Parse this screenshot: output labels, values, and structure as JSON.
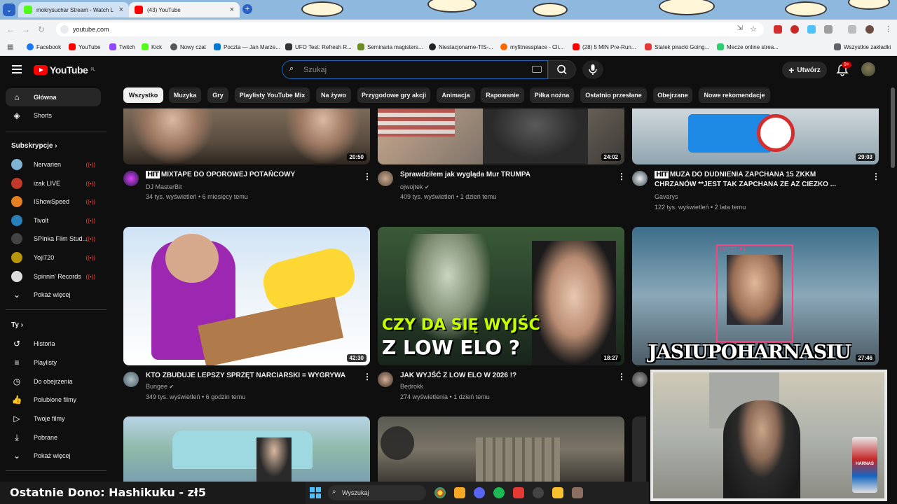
{
  "browser": {
    "tabs": [
      {
        "label": "mokrysuchar Stream - Watch L",
        "favicon_color": "#53fc18"
      },
      {
        "label": "(43) YouTube",
        "favicon_color": "#ff0000"
      }
    ],
    "url": "youtube.com",
    "bookmarks": [
      {
        "label": "Facebook",
        "color": "#1877f2"
      },
      {
        "label": "YouTube",
        "color": "#ff0000"
      },
      {
        "label": "Twitch",
        "color": "#9146ff"
      },
      {
        "label": "Kick",
        "color": "#53fc18"
      },
      {
        "label": "Nowy czat",
        "color": "#555555"
      },
      {
        "label": "Poczta — Jan Marze...",
        "color": "#0078d4"
      },
      {
        "label": "UFO Test: Refresh R...",
        "color": "#333333"
      },
      {
        "label": "Seminaria magisters...",
        "color": "#6b8e23"
      },
      {
        "label": "Niestacjonarne-TIS-...",
        "color": "#222222"
      },
      {
        "label": "myfitnessplace - Cli...",
        "color": "#ff6a00"
      },
      {
        "label": "(28) 5 MIN Pre-Run...",
        "color": "#ff0000"
      },
      {
        "label": "Statek piracki Going...",
        "color": "#e53935"
      },
      {
        "label": "Mecze online strea...",
        "color": "#2ecc71"
      }
    ],
    "all_bookmarks": "Wszystkie zakładki"
  },
  "header": {
    "logo": "YouTube",
    "region": "PL",
    "search_placeholder": "Szukaj",
    "create_label": "Utwórz",
    "notifications": "9+"
  },
  "sidebar": {
    "main": [
      {
        "label": "Główna",
        "icon": "home-icon",
        "glyph": "⌂"
      },
      {
        "label": "Shorts",
        "icon": "shorts-icon",
        "glyph": "◈"
      }
    ],
    "subscriptions_heading": "Subskrypcje",
    "subscriptions": [
      {
        "label": "Nervarien",
        "color": "#7fb3d5"
      },
      {
        "label": "izak LIVE",
        "color": "#c0392b"
      },
      {
        "label": "IShowSpeed",
        "color": "#e67e22"
      },
      {
        "label": "Tivolt",
        "color": "#2980b9"
      },
      {
        "label": "SPInka Film Stud...",
        "color": "#444444"
      },
      {
        "label": "Yoji720",
        "color": "#b7950b"
      },
      {
        "label": "Spinnin' Records",
        "color": "#dddddd"
      }
    ],
    "show_more": "Pokaż więcej",
    "you_heading": "Ty",
    "you_items": [
      {
        "label": "Historia",
        "icon": "history-icon",
        "glyph": "↺"
      },
      {
        "label": "Playlisty",
        "icon": "playlists-icon",
        "glyph": "≡"
      },
      {
        "label": "Do obejrzenia",
        "icon": "watch-later-icon",
        "glyph": "◷"
      },
      {
        "label": "Polubione filmy",
        "icon": "liked-icon",
        "glyph": "👍"
      },
      {
        "label": "Twoje filmy",
        "icon": "your-videos-icon",
        "glyph": "▷"
      },
      {
        "label": "Pobrane",
        "icon": "downloads-icon",
        "glyph": "⤓"
      }
    ],
    "show_more_2": "Pokaż więcej"
  },
  "chips": [
    "Wszystko",
    "Muzyka",
    "Gry",
    "Playlisty YouTube Mix",
    "Na żywo",
    "Przygodowe gry akcji",
    "Animacja",
    "Rapowanie",
    "Piłka nożna",
    "Ostatnio przesłane",
    "Obejrzane",
    "Nowe rekomendacje"
  ],
  "videos_row1": [
    {
      "hit": "HIT",
      "title": "MIXTAPE DO OPOROWEJ POTAŃCOWY",
      "channel": "DJ MasterBit",
      "meta": "34 tys. wyświetleń • 6 miesięcy temu",
      "duration": "20:50",
      "verified": false
    },
    {
      "hit": "",
      "title": "Sprawdziłem jak wygląda Mur TRUMPA",
      "channel": "ojwojtek",
      "meta": "409 tys. wyświetleń • 1 dzień temu",
      "duration": "24:02",
      "verified": true
    },
    {
      "hit": "HIT",
      "title": "MUZA DO DUDNIENIA ZAPCHANA 15 ZKKM",
      "title2": "CHRZANÓW **JEST TAK ZAPCHANA ZE AZ CIEZKO ...",
      "channel": "Gavarys",
      "meta": "122 tys. wyświetleń • 2 lata temu",
      "duration": "29:03",
      "verified": false
    }
  ],
  "videos_row2": [
    {
      "title": "KTO ZBUDUJE LEPSZY SPRZĘT NARCIARSKI = WYGRYWA",
      "channel": "Bungee",
      "meta": "349 tys. wyświetleń • 6 godzin temu",
      "duration": "42:30",
      "verified": true
    },
    {
      "title": "JAK WYJŚĆ Z LOW ELO W 2026 !?",
      "channel": "Bedrokk",
      "meta": "274 wyświetlenia • 1 dzień temu",
      "duration": "18:27",
      "verified": false,
      "thumb_text1": "CZY DA SIĘ WYJŚĆ",
      "thumb_text2": "Z LOW ELO ?"
    },
    {
      "duration": "27:46",
      "thumb_text1": "TARGET 01"
    }
  ],
  "overlay": {
    "stream_title": "JASIUPOHARNASIU",
    "dono": "Ostatnie Dono: Hashikuku - zł5",
    "can_label": "HARNAŚ"
  },
  "taskbar": {
    "search_label": "Wyszukaj"
  }
}
